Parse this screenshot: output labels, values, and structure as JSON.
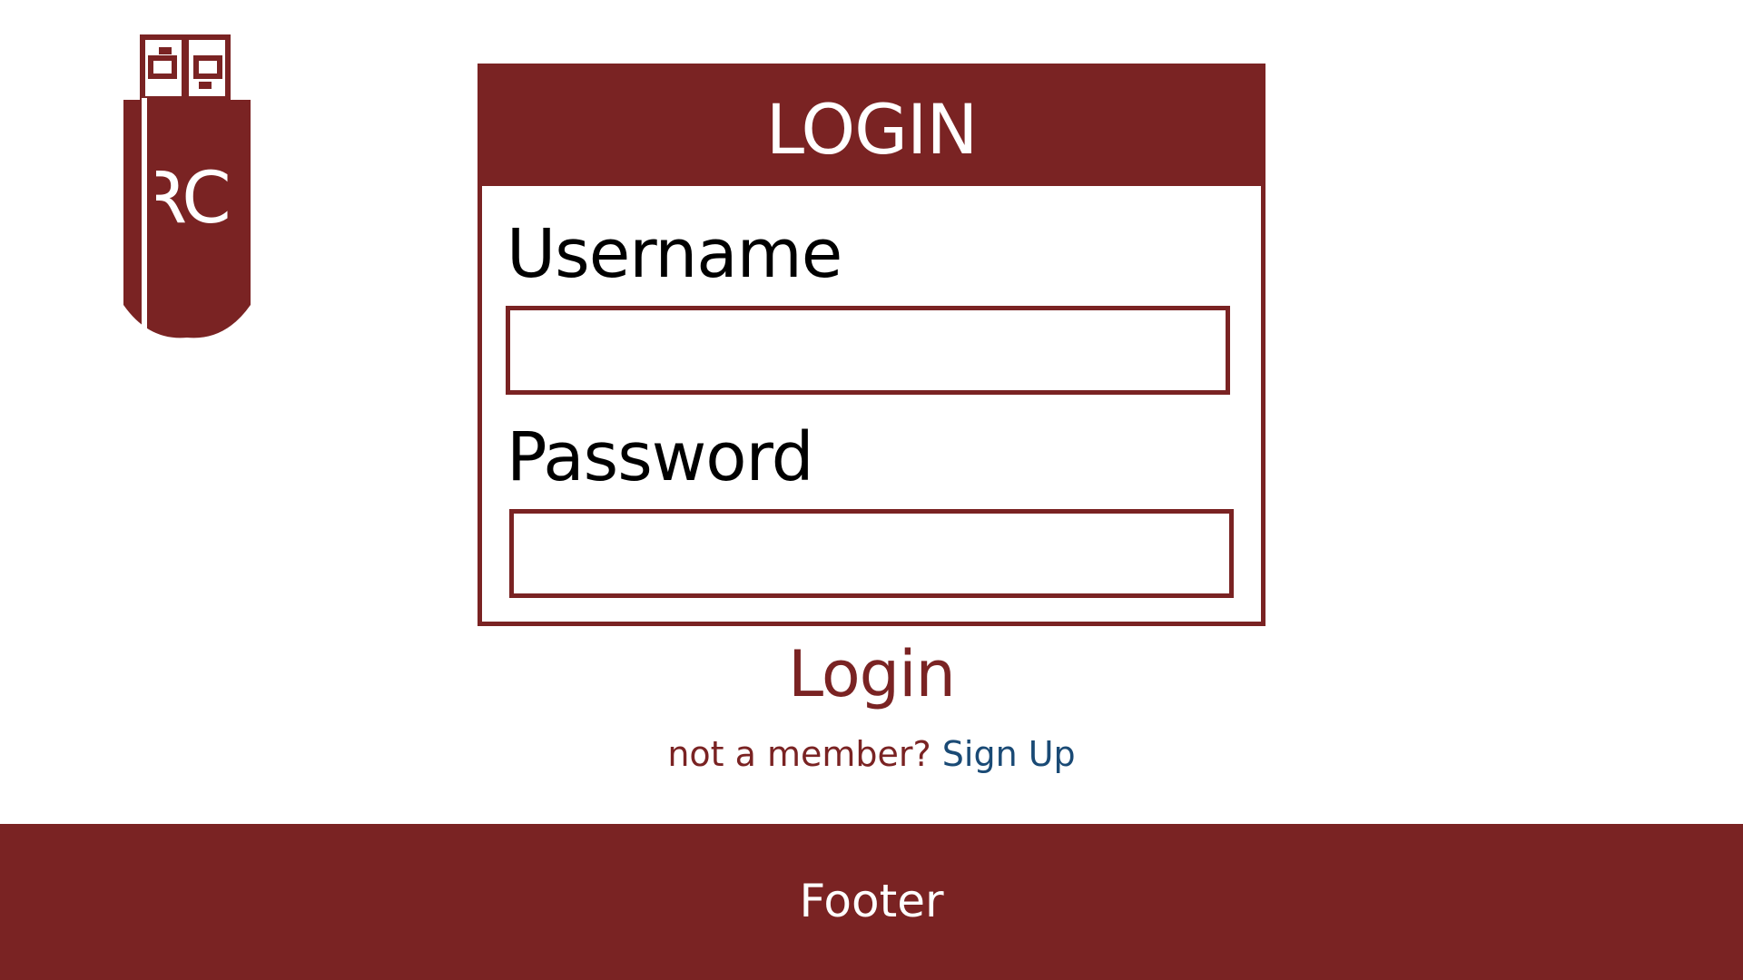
{
  "logo": {
    "text": "RC",
    "icon": "usb-drive-icon",
    "color": "#7a2323"
  },
  "login_card": {
    "title": "LOGIN",
    "username_label": "Username",
    "username_value": "",
    "password_label": "Password",
    "password_value": ""
  },
  "actions": {
    "login_label": "Login",
    "member_prompt": "not a member?",
    "signup_label": "Sign Up"
  },
  "footer": {
    "text": "Footer"
  },
  "colors": {
    "brand": "#7a2323",
    "link": "#1a4a75",
    "background": "#ffffff"
  }
}
